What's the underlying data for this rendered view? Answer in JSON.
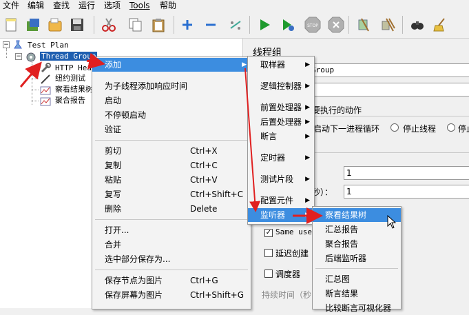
{
  "menubar": [
    "文件",
    "编辑",
    "查找",
    "运行",
    "选项",
    "Tools",
    "帮助"
  ],
  "tree": {
    "root": "Test Plan",
    "thread_group": "Thread Group",
    "children": [
      "HTTP Head",
      "纽约测试",
      "察看结果树",
      "聚合报告"
    ]
  },
  "panel": {
    "title": "线程组",
    "name_value": "Group",
    "action_label": "要执行的动作",
    "radio_next_loop": "启动下一进程循环",
    "radio_stop_thread": "停止线程",
    "radio_stop_test": "停止",
    "threads_value": "1",
    "rampup_label": "秒）：",
    "rampup_value": "1",
    "same_user": "Same use",
    "delay_create": "延迟创建",
    "scheduler": "调度器",
    "duration": "持续时间（秒"
  },
  "context_menu": {
    "add": "添加",
    "add_think_time": "为子线程添加响应时间",
    "start": "启动",
    "start_no_pause": "不停顿启动",
    "validate": "验证",
    "cut": "剪切",
    "cut_sc": "Ctrl+X",
    "copy": "复制",
    "copy_sc": "Ctrl+C",
    "paste": "粘贴",
    "paste_sc": "Ctrl+V",
    "duplicate": "复写",
    "duplicate_sc": "Ctrl+Shift+C",
    "delete": "删除",
    "delete_sc": "Delete",
    "open": "打开...",
    "merge": "合并",
    "save_selection": "选中部分保存为...",
    "save_node_image": "保存节点为图片",
    "save_node_image_sc": "Ctrl+G",
    "save_screen_image": "保存屏幕为图片",
    "save_screen_image_sc": "Ctrl+Shift+G"
  },
  "add_submenu": {
    "sampler": "取样器",
    "logic_controller": "逻辑控制器",
    "pre_processor": "前置处理器",
    "post_processor": "后置处理器",
    "assertion": "断言",
    "timer": "定时器",
    "test_fragment": "测试片段",
    "config_element": "配置元件",
    "listener": "监听器"
  },
  "listener_submenu": {
    "view_results_tree": "察看结果树",
    "summary_report": "汇总报告",
    "aggregate_report": "聚合报告",
    "backend_listener": "后端监听器",
    "summary_graph": "汇总图",
    "assertion_results": "断言结果",
    "comparison_visualizer": "比较断言可视化器"
  },
  "colors": {
    "highlight": "#3c8de0",
    "annotation_arrow": "#e02020"
  }
}
